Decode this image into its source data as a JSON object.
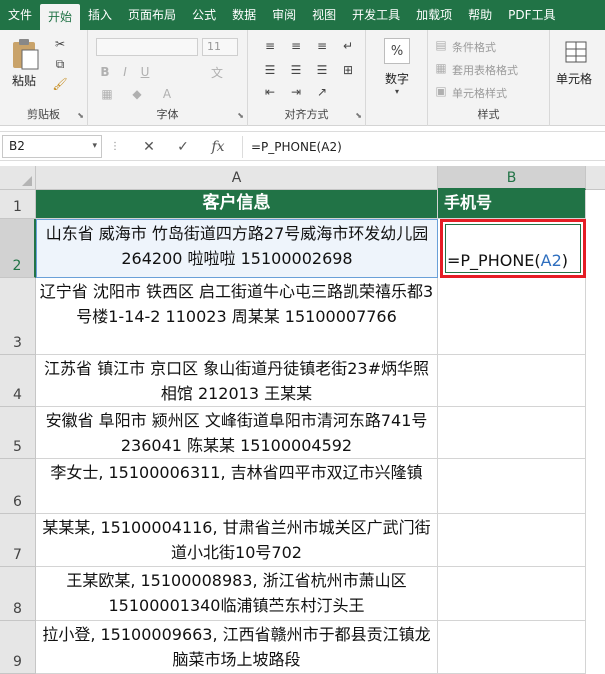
{
  "tabs": [
    "文件",
    "开始",
    "插入",
    "页面布局",
    "公式",
    "数据",
    "审阅",
    "视图",
    "开发工具",
    "加载项",
    "帮助",
    "PDF工具"
  ],
  "active_tab": "开始",
  "ribbon": {
    "clipboard": {
      "label": "剪贴板",
      "paste": "粘贴"
    },
    "font": {
      "label": "字体",
      "size": "11"
    },
    "alignment": {
      "label": "对齐方式"
    },
    "number": {
      "label": "数字",
      "percent_symbol": "%"
    },
    "styles": {
      "label": "样式",
      "conditional": "条件格式",
      "table_format": "套用表格格式",
      "cell_styles": "单元格样式"
    },
    "cells": {
      "label": "单元格"
    }
  },
  "formula_bar": {
    "name_box": "B2",
    "formula": "=P_PHONE(A2)"
  },
  "columns": [
    "A",
    "B"
  ],
  "rows": [
    {
      "num": "1",
      "a": "客户信息",
      "b": "手机号"
    },
    {
      "num": "2",
      "a": "山东省 威海市 竹岛街道四方路27号威海市环发幼儿园 264200 啦啦啦 15100002698",
      "b": ""
    },
    {
      "num": "3",
      "a": "辽宁省 沈阳市 铁西区 启工街道牛心屯三路凯荣禧乐都3号楼1-14-2 110023 周某某 15100007766",
      "b": ""
    },
    {
      "num": "4",
      "a": "江苏省 镇江市 京口区 象山街道丹徒镇老街23#炳华照相馆 212013 王某某",
      "b": ""
    },
    {
      "num": "5",
      "a": "安徽省 阜阳市 颍州区 文峰街道阜阳市清河东路741号 236041 陈某某 15100004592",
      "b": ""
    },
    {
      "num": "6",
      "a": "李女士, 15100006311, 吉林省四平市双辽市兴隆镇",
      "b": ""
    },
    {
      "num": "7",
      "a": "某某某, 15100004116, 甘肃省兰州市城关区广武门街道小北街10号702",
      "b": ""
    },
    {
      "num": "8",
      "a": "王某欧某, 15100008983, 浙江省杭州市萧山区15100001340临浦镇苎东村汀头王",
      "b": ""
    },
    {
      "num": "9",
      "a": "拉小登, 15100009663, 江西省赣州市于都县贡江镇龙脑菜市场上坡路段",
      "b": ""
    }
  ],
  "editing_cell": {
    "prefix": "=P_PHONE(",
    "ref": "A2",
    "suffix": ")"
  },
  "colors": {
    "brand": "#217346",
    "highlight": "#e41e25",
    "ref": "#2f6fbf"
  }
}
